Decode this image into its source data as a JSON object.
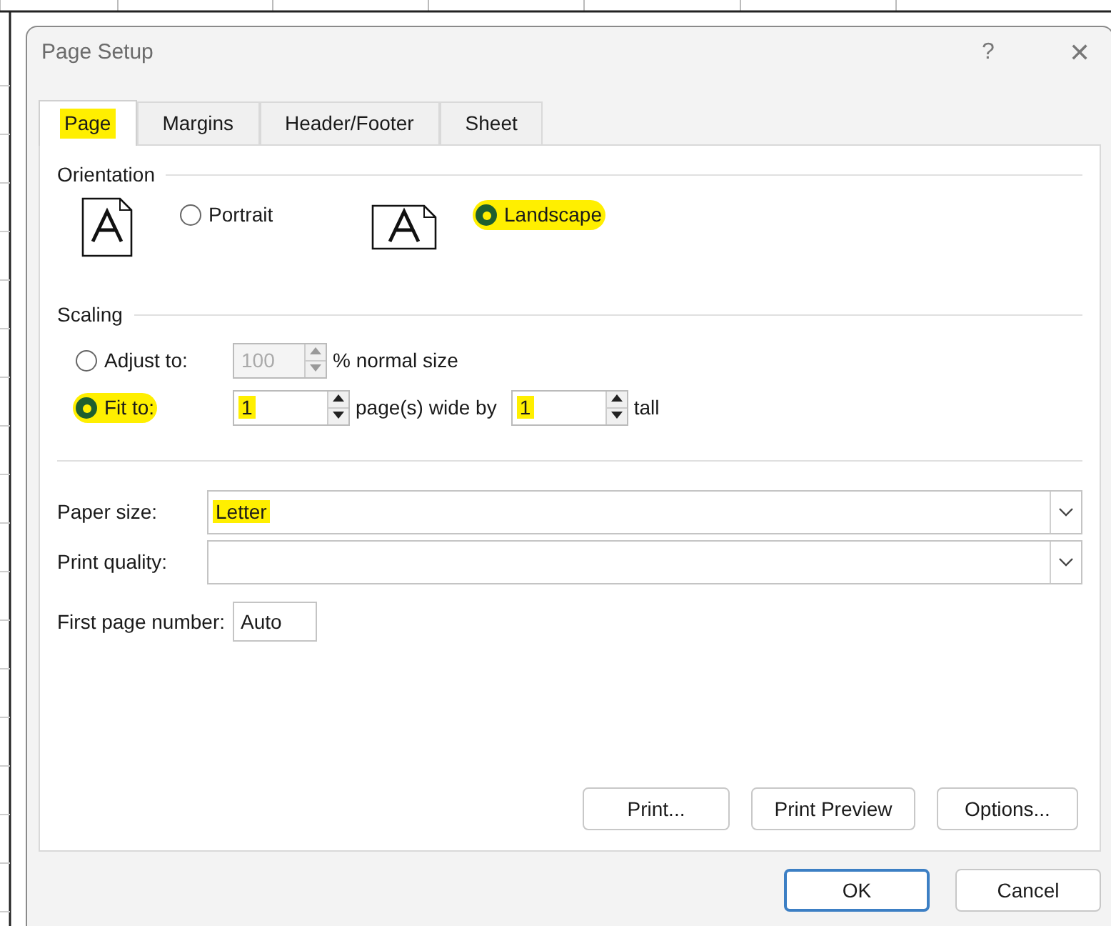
{
  "window": {
    "title": "Page Setup",
    "help": "?",
    "close": "✕"
  },
  "tabs": [
    {
      "label": "Page",
      "selected": true,
      "highlighted": true
    },
    {
      "label": "Margins",
      "selected": false,
      "highlighted": false
    },
    {
      "label": "Header/Footer",
      "selected": false,
      "highlighted": false
    },
    {
      "label": "Sheet",
      "selected": false,
      "highlighted": false
    }
  ],
  "orientation": {
    "heading": "Orientation",
    "options": [
      {
        "kind": "portrait",
        "label": "Portrait",
        "selected": false,
        "highlighted": false
      },
      {
        "kind": "landscape",
        "label": "Landscape",
        "selected": true,
        "highlighted": true
      }
    ]
  },
  "scaling": {
    "heading": "Scaling",
    "adjust": {
      "label": "Adjust to:",
      "selected": false,
      "highlighted": false,
      "value": "100",
      "disabled": true,
      "suffix": "% normal size"
    },
    "fit": {
      "label": "Fit to:",
      "selected": true,
      "highlighted": true,
      "wide": {
        "value": "1",
        "highlighted": true
      },
      "wide_label": "page(s) wide by",
      "tall": {
        "value": "1",
        "highlighted": true
      },
      "tall_label": "tall"
    }
  },
  "paper_size": {
    "label": "Paper size:",
    "value": "Letter",
    "highlighted": true
  },
  "print_quality": {
    "label": "Print quality:"
  },
  "first_page_number": {
    "label": "First page number:",
    "value": "Auto"
  },
  "panel_buttons": [
    "Print...",
    "Print Preview",
    "Options..."
  ],
  "dialog_buttons": [
    {
      "label": "OK",
      "default": true
    },
    {
      "label": "Cancel",
      "default": false
    }
  ]
}
